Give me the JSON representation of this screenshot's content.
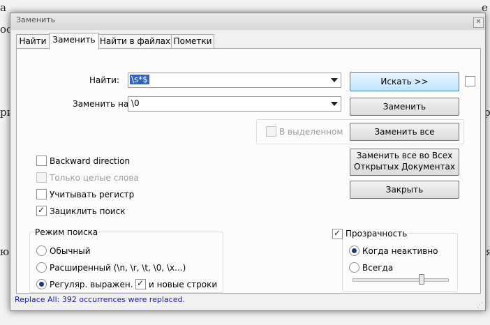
{
  "background": {
    "line1_left": "а",
    "line1_right": "е",
    "line2_left": "ос",
    "line3_left": "ри",
    "line3_right": "р",
    "line4_left": "ю",
    "line4_right": "ня"
  },
  "window": {
    "title": "Заменить",
    "close": "✕"
  },
  "tabs": [
    {
      "label": "Найти"
    },
    {
      "label": "Заменить"
    },
    {
      "label": "Найти в файлах"
    },
    {
      "label": "Пометки"
    }
  ],
  "find": {
    "label": "Найти:",
    "value": "\\s*$"
  },
  "replace": {
    "label": "Заменить на:",
    "value": "\\0"
  },
  "buttons": {
    "find_next": "Искать >>",
    "replace": "Заменить",
    "replace_all": "Заменить все",
    "replace_all_docs_line1": "Заменить все во Всех",
    "replace_all_docs_line2": "Открытых Документах",
    "close": "Закрыть"
  },
  "in_selection": {
    "label": "В выделенном",
    "checked": false
  },
  "options": {
    "backward": "Backward direction",
    "whole_word": "Только целые слова",
    "match_case": "Учитывать регистр",
    "wrap": "Зациклить поиск"
  },
  "search_mode": {
    "title": "Режим поиска",
    "normal": "Обычный",
    "extended": "Расширенный (\\n, \\r, \\t, \\0, \\x...)",
    "regex": "Регуляр. выражен.",
    "newline": "и новые строки",
    "selected": "regex"
  },
  "transparency": {
    "label": "Прозрачность",
    "on_lose_focus": "Когда неактивно",
    "always": "Всегда",
    "level": 0.72
  },
  "status": "Replace All: 392 occurrences were replaced."
}
